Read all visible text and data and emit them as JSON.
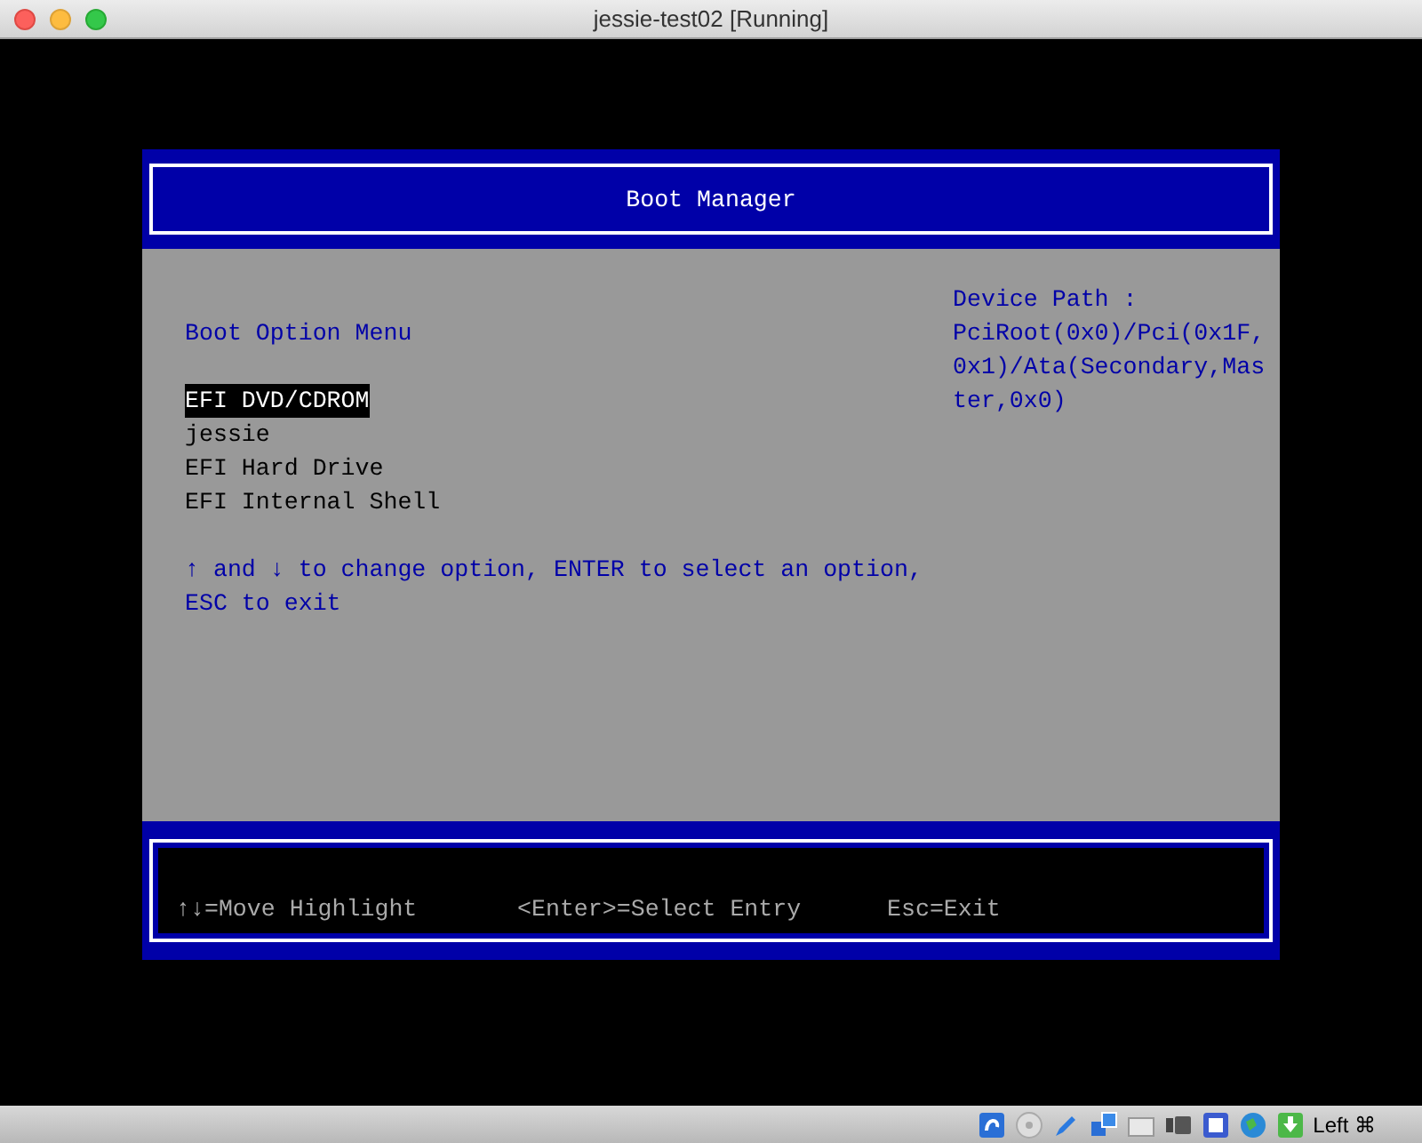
{
  "window": {
    "title": "jessie-test02 [Running]"
  },
  "boot_manager": {
    "title": "Boot Manager",
    "menu_title": "Boot Option Menu",
    "options": [
      {
        "label": "EFI DVD/CDROM",
        "selected": true
      },
      {
        "label": "jessie",
        "selected": false
      },
      {
        "label": "EFI Hard Drive",
        "selected": false
      },
      {
        "label": "EFI Internal Shell",
        "selected": false
      }
    ],
    "help": "↑ and ↓ to change option, ENTER to select an option, ESC to exit",
    "device_path_label": "Device Path :",
    "device_path": "PciRoot(0x0)/Pci(0x1F,0x1)/Ata(Secondary,Master,0x0)",
    "footer": [
      "↑↓=Move Highlight",
      "<Enter>=Select Entry",
      "Esc=Exit"
    ]
  },
  "status_bar": {
    "host_key": "Left ⌘"
  }
}
